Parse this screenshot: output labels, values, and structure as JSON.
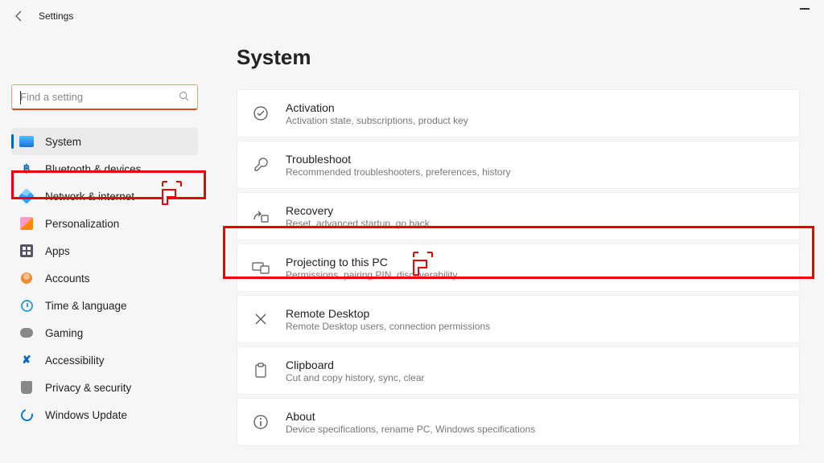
{
  "app_title": "Settings",
  "search": {
    "placeholder": "Find a setting"
  },
  "sidebar": {
    "items": [
      {
        "label": "System",
        "icon": "i-system",
        "active": true
      },
      {
        "label": "Bluetooth & devices",
        "icon": "i-bt"
      },
      {
        "label": "Network & internet",
        "icon": "i-net"
      },
      {
        "label": "Personalization",
        "icon": "i-pers"
      },
      {
        "label": "Apps",
        "icon": "i-apps"
      },
      {
        "label": "Accounts",
        "icon": "i-acc"
      },
      {
        "label": "Time & language",
        "icon": "i-time"
      },
      {
        "label": "Gaming",
        "icon": "i-game"
      },
      {
        "label": "Accessibility",
        "icon": "i-a11y"
      },
      {
        "label": "Privacy & security",
        "icon": "i-priv"
      },
      {
        "label": "Windows Update",
        "icon": "i-upd"
      }
    ]
  },
  "page": {
    "title": "System",
    "cards": [
      {
        "title": "Activation",
        "sub": "Activation state, subscriptions, product key",
        "icon": "check"
      },
      {
        "title": "Troubleshoot",
        "sub": "Recommended troubleshooters, preferences, history",
        "icon": "wrench"
      },
      {
        "title": "Recovery",
        "sub": "Reset, advanced startup, go back",
        "icon": "recovery"
      },
      {
        "title": "Projecting to this PC",
        "sub": "Permissions, pairing PIN, discoverability",
        "icon": "project"
      },
      {
        "title": "Remote Desktop",
        "sub": "Remote Desktop users, connection permissions",
        "icon": "remote"
      },
      {
        "title": "Clipboard",
        "sub": "Cut and copy history, sync, clear",
        "icon": "clipboard"
      },
      {
        "title": "About",
        "sub": "Device specifications, rename PC, Windows specifications",
        "icon": "info"
      }
    ]
  }
}
